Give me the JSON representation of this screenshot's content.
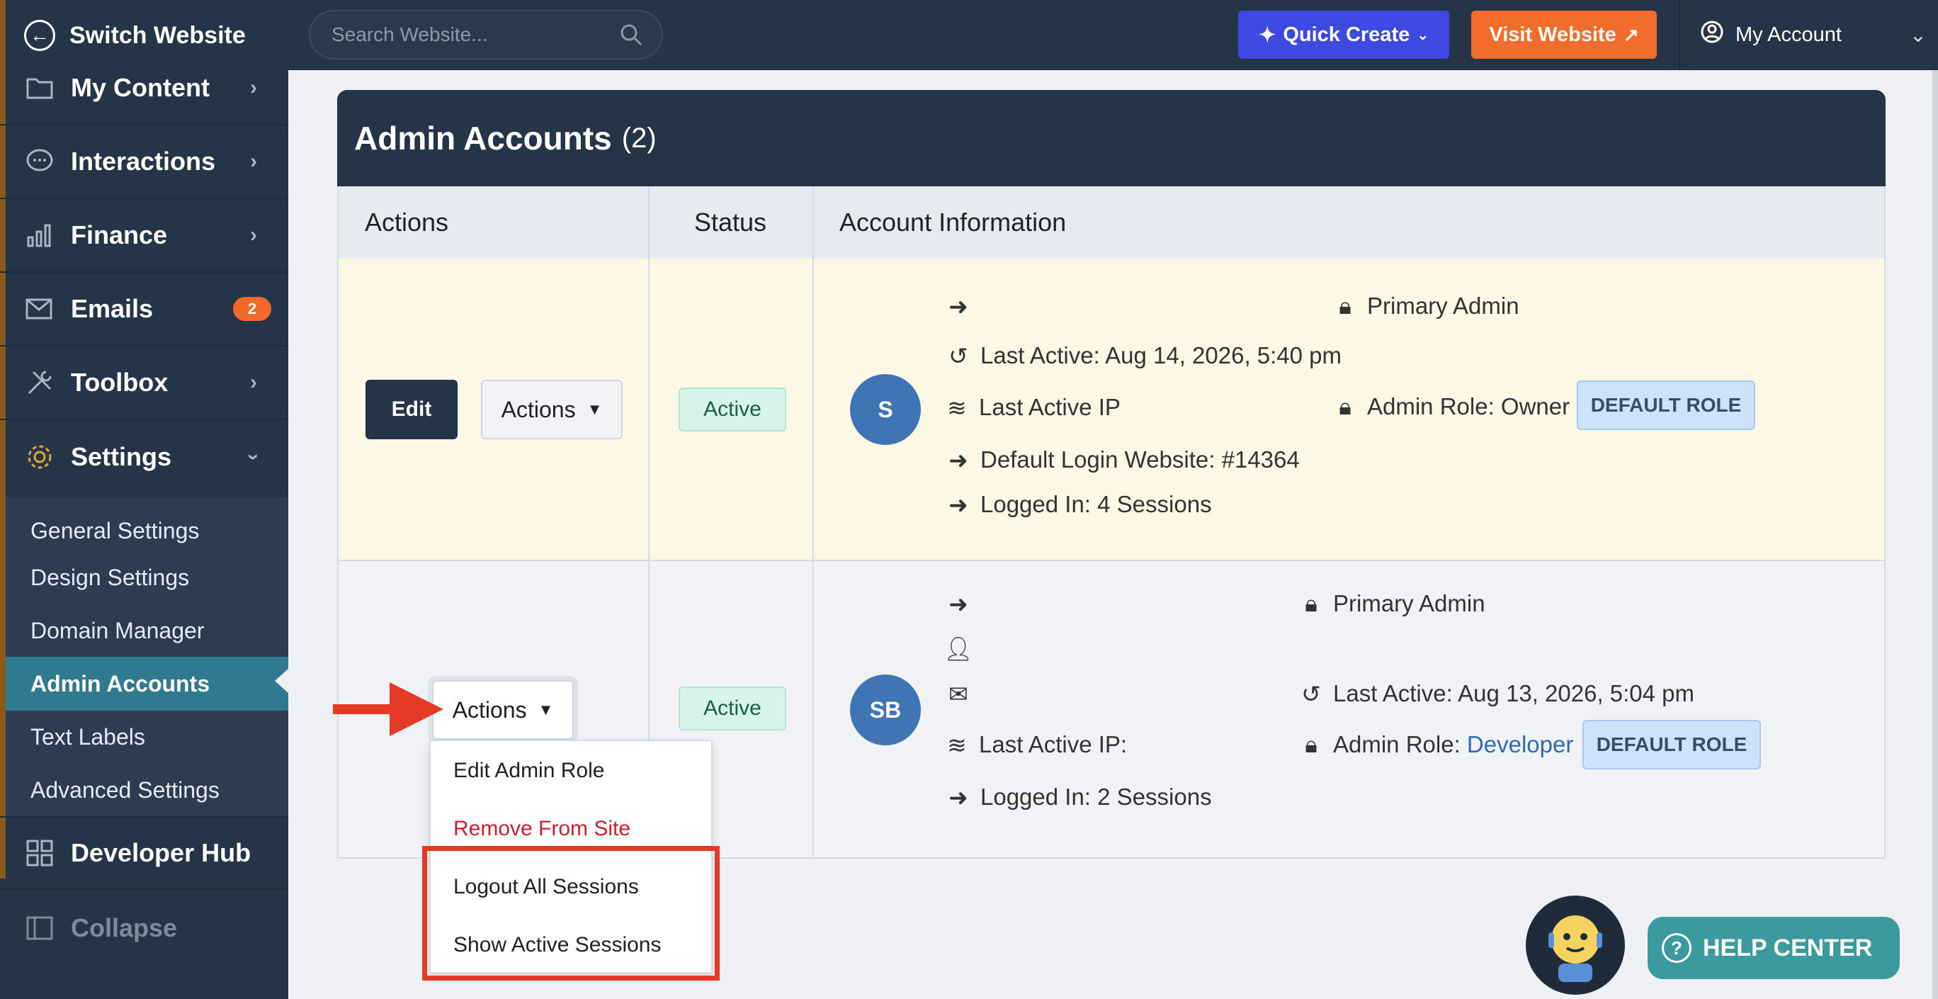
{
  "sidebar": {
    "switch_label": "Switch Website",
    "items": [
      {
        "label": "My Content",
        "icon": "folder-icon"
      },
      {
        "label": "Interactions",
        "icon": "chat-icon"
      },
      {
        "label": "Finance",
        "icon": "bar-chart-icon"
      },
      {
        "label": "Emails",
        "icon": "mail-icon",
        "badge": "2"
      },
      {
        "label": "Toolbox",
        "icon": "tools-icon"
      },
      {
        "label": "Settings",
        "icon": "gear-icon"
      },
      {
        "label": "Developer Hub",
        "icon": "grid-icon"
      },
      {
        "label": "Collapse",
        "icon": "collapse-icon"
      }
    ],
    "settings_submenu": [
      "General Settings",
      "Design Settings",
      "Domain Manager",
      "Admin Accounts",
      "Text Labels",
      "Advanced Settings"
    ],
    "active_submenu": "Admin Accounts"
  },
  "topbar": {
    "search_placeholder": "Search Website...",
    "quick_create": "Quick Create",
    "visit_website": "Visit Website",
    "my_account": "My Account"
  },
  "panel": {
    "title": "Admin Accounts",
    "count": "(2)",
    "columns": [
      "Actions",
      "Status",
      "Account Information"
    ]
  },
  "rows": [
    {
      "edit_label": "Edit",
      "actions_label": "Actions",
      "status": "Active",
      "avatar": "S",
      "last_active": "Last Active: Aug 14, 2026, 5:40 pm",
      "last_ip": "Last Active IP",
      "default_login": "Default Login Website: #14364",
      "logged_in": "Logged In: 4 Sessions",
      "primary": "Primary Admin",
      "role_prefix": "Admin Role: Owner",
      "role_badge": "DEFAULT ROLE"
    },
    {
      "actions_label": "Actions",
      "status": "Active",
      "avatar": "SB",
      "last_ip": "Last Active IP: ",
      "logged_in": "Logged In: 2 Sessions",
      "primary": "Primary Admin",
      "last_active": "Last Active: Aug 13, 2026, 5:04 pm",
      "role_prefix": "Admin Role: ",
      "role_link": "Developer",
      "role_badge": "DEFAULT ROLE"
    }
  ],
  "dropdown": {
    "items": [
      "Edit Admin Role",
      "Remove From Site",
      "Logout All Sessions",
      "Show Active Sessions"
    ]
  },
  "help_center": "HELP CENTER",
  "colors": {
    "sidebar_bg": "#263447",
    "active_submenu": "#2f7a8e",
    "quick_create": "#3d49e0",
    "visit_website": "#f26d2c",
    "annotation_red": "#e53a26",
    "help_center": "#3a9a9e"
  }
}
